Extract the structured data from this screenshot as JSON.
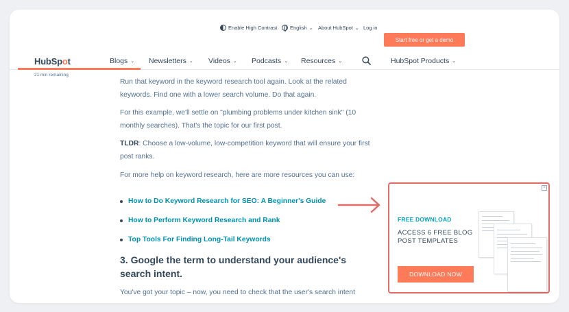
{
  "utility_bar": {
    "contrast": "Enable High Contrast",
    "language": "English",
    "about": "About HubSpot",
    "login": "Log in",
    "cta": "Start free or get a demo"
  },
  "nav": {
    "logo_prefix": "HubSp",
    "logo_o": "o",
    "logo_suffix": "t",
    "items": [
      "Blogs",
      "Newsletters",
      "Videos",
      "Podcasts",
      "Resources"
    ],
    "products": "HubSpot Products"
  },
  "reading": {
    "remaining": "21 min remaining",
    "progress_fraction": 0.23
  },
  "article": {
    "p1": "Run that keyword in the keyword research tool again. Look at the related keywords. Find one with a lower search volume. Do that again.",
    "p2": "For this example, we'll settle on \"plumbing problems under kitchen sink\" (10 monthly searches). That's the topic for our first post.",
    "tldr_label": "TLDR",
    "tldr_text": ": Choose a low-volume, low-competition keyword that will ensure your first post ranks.",
    "p4": "For more help on keyword research, here are more resources you can use:",
    "links": [
      "How to Do Keyword Research for SEO: A Beginner's Guide",
      "How to Perform Keyword Research and Rank",
      "Top Tools For Finding Long-Tail Keywords"
    ],
    "heading": "3. Google the term to understand your audience's search intent.",
    "p5": "You've got your topic – now, you need to check that the user's search intent"
  },
  "ad": {
    "eyebrow": "FREE DOWNLOAD",
    "headline": "ACCESS 6 FREE BLOG POST TEMPLATES",
    "button": "DOWNLOAD NOW",
    "close": "×"
  },
  "colors": {
    "accent": "#ff7a59",
    "link": "#0091ae",
    "text": "#33475b",
    "highlight_border": "#e26b66"
  }
}
